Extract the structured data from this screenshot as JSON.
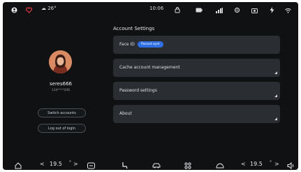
{
  "status_bar": {
    "temperature": "☁ 26°",
    "time": "10:06"
  },
  "profile": {
    "username": "seres666",
    "user_id": "134****206",
    "switch_accounts_label": "Switch accounts",
    "logout_label": "Log out of login"
  },
  "settings": {
    "title": "Account Settings",
    "items": [
      {
        "label": "Face ID",
        "badge": "Passed ayst"
      },
      {
        "label": "Cache account management"
      },
      {
        "label": "Password settings"
      },
      {
        "label": "About"
      }
    ]
  },
  "dock": {
    "left_temp": "19.5",
    "right_temp": "19.5",
    "left_arrow": "<",
    "left_arrow_right": ">",
    "right_arrow": "<",
    "right_arrow_right": ">"
  },
  "colors": {
    "background": "#0f1113",
    "card": "#2a2d31",
    "accent": "#2f6fe4",
    "status_red": "#e0383e"
  },
  "icons": {
    "status": [
      "owner-icon",
      "heart-icon",
      "cloud-icon",
      "bag-icon",
      "battery-icon",
      "signal-icon",
      "settings-icon",
      "camera-icon",
      "flash-icon",
      "wifi-icon"
    ],
    "dock": [
      "home-icon",
      "fan-icon",
      "seat-icon",
      "car-icon",
      "apps-icon",
      "defrost-icon",
      "volume-icon"
    ]
  }
}
